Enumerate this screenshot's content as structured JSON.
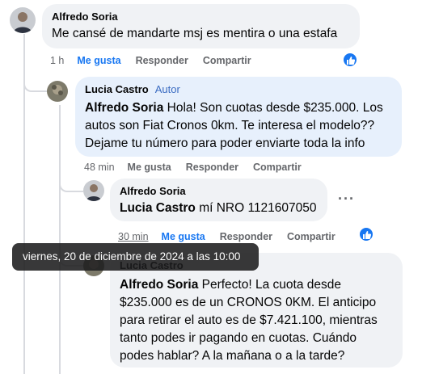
{
  "comments": [
    {
      "author": "Alfredo Soria",
      "text": "Me cansé de mandarte msj es mentira o una estafa",
      "time": "1 h",
      "like_label": "Me gusta",
      "reply_label": "Responder",
      "share_label": "Compartir"
    },
    {
      "author": "Lucia Castro",
      "badge": "Autor",
      "mention": "Alfredo Soria",
      "text": " Hola! Son cuotas desde $235.000. Los autos son Fiat Cronos 0km. Te interesa el modelo?? Dejame tu número para poder enviarte toda la info",
      "time": "48 min",
      "like_label": "Me gusta",
      "reply_label": "Responder",
      "share_label": "Compartir"
    },
    {
      "author": "Alfredo Soria",
      "mention": "Lucia Castro",
      "text": " mí NRO 1121607050",
      "time": "30 min",
      "like_label": "Me gusta",
      "reply_label": "Responder",
      "share_label": "Compartir",
      "more": "···"
    },
    {
      "author": "Lucia Castro",
      "mention": "Alfredo Soria",
      "text": " Perfecto! La cuota desde $235.000 es de un CRONOS 0KM. El anticipo para retirar el auto es de $7.421.100, mientras tanto podes ir pagando en cuotas. Cuándo podes hablar? A la mañana o a la tarde?"
    }
  ],
  "tooltip": "viernes, 20 de diciembre de 2024 a las 10:00",
  "colors": {
    "like_blue": "#1877f2",
    "secondary_text": "#65676b",
    "bubble_grey": "#f0f2f5",
    "bubble_blue": "#e7f0fc"
  },
  "icons": [
    "thumbs-up-icon",
    "more-options-icon"
  ]
}
